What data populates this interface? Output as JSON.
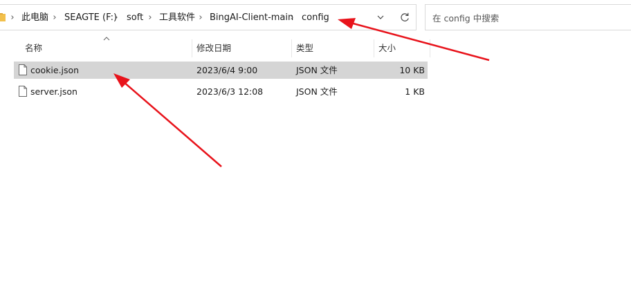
{
  "breadcrumb": {
    "items": [
      "此电脑",
      "SEAGTE (F:)",
      "soft",
      "工具软件",
      "BingAI-Client-main",
      "config"
    ],
    "separator": "›"
  },
  "search": {
    "placeholder": "在 config 中搜索"
  },
  "columns": {
    "name": "名称",
    "modified": "修改日期",
    "type": "类型",
    "size": "大小"
  },
  "files": [
    {
      "name": "cookie.json",
      "modified": "2023/6/4 9:00",
      "type": "JSON 文件",
      "size": "10 KB",
      "selected": true
    },
    {
      "name": "server.json",
      "modified": "2023/6/3 12:08",
      "type": "JSON 文件",
      "size": "1 KB",
      "selected": false
    }
  ],
  "icons": {
    "folder": "folder-icon",
    "dropdown": "chevron-down-icon",
    "refresh": "refresh-icon",
    "file": "file-icon",
    "sort": "sort-up-icon"
  },
  "colors": {
    "selected_row": "#d5d5d5",
    "annotation_arrow": "#e8131b",
    "folder": "#f2c04c"
  }
}
